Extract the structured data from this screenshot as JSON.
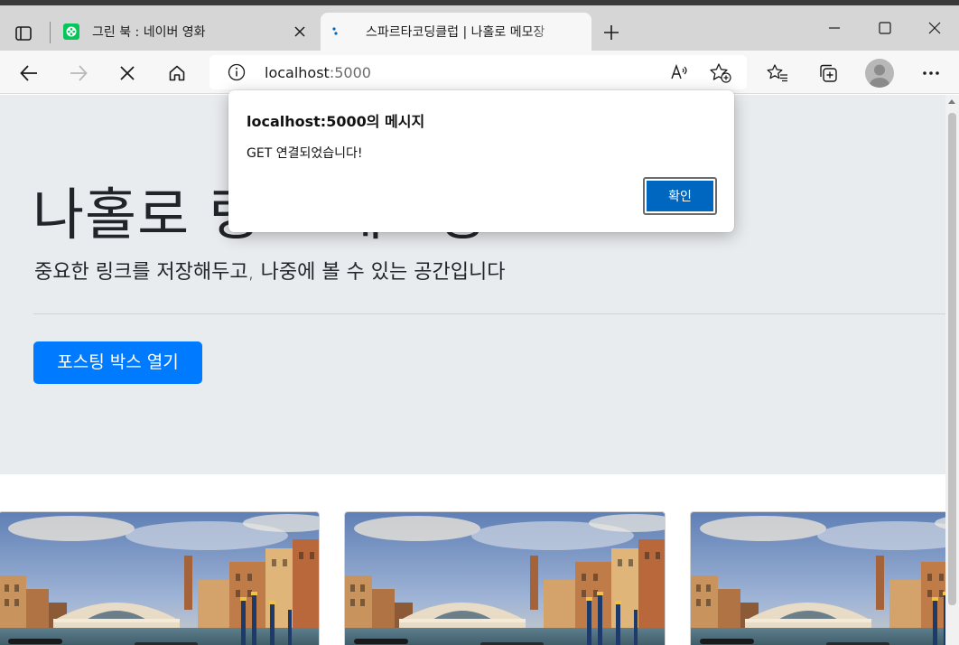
{
  "browser": {
    "tabs": [
      {
        "title": "그린 북 : 네이버 영화",
        "favicon": "naver-movie-icon",
        "active": false
      },
      {
        "title": "스파르타코딩클럽 | 나홀로 메모장",
        "favicon": "loading-spinner-icon",
        "active": true
      }
    ],
    "address": {
      "host": "localhost",
      "port": ":5000"
    },
    "accent_color": "#0067c0"
  },
  "page": {
    "title": "나홀로 링크 메모장",
    "subtitle": "중요한 링크를 저장해두고, 나중에 볼 수 있는 공간입니다",
    "posting_button": "포스팅 박스 열기",
    "button_color": "#007bff",
    "jumbotron_color": "#e9ecef",
    "card_count": 3
  },
  "alert": {
    "title": "localhost:5000의 메시지",
    "message": "GET 연결되었습니다!",
    "ok_label": "확인"
  }
}
